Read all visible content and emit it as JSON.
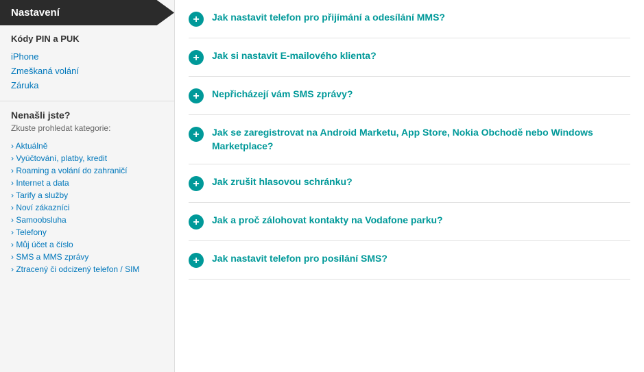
{
  "sidebar": {
    "header": "Nastavení",
    "section1": {
      "title": "Kódy PIN a PUK",
      "links": [
        {
          "label": "iPhone",
          "href": "#"
        },
        {
          "label": "Zmeškaná volání",
          "href": "#"
        },
        {
          "label": "Záruka",
          "href": "#"
        }
      ]
    },
    "nenasli": {
      "title": "Nenašli jste?",
      "subtitle": "Zkuste prohledat kategorie:",
      "categories": [
        {
          "label": "Aktuálně"
        },
        {
          "label": "Vyúčtování, platby, kredit"
        },
        {
          "label": "Roaming a volání do zahraničí"
        },
        {
          "label": "Internet a data"
        },
        {
          "label": "Tarify a služby"
        },
        {
          "label": "Noví zákazníci"
        },
        {
          "label": "Samoobsluha"
        },
        {
          "label": "Telefony"
        },
        {
          "label": "Můj účet a číslo"
        },
        {
          "label": "SMS a MMS zprávy"
        },
        {
          "label": "Ztracený či odcizený telefon / SIM"
        }
      ]
    }
  },
  "faq": {
    "items": [
      {
        "question": "Jak nastavit telefon pro přijímání a odesílání MMS?"
      },
      {
        "question": "Jak si nastavit E-mailového klienta?"
      },
      {
        "question": "Nepřicházejí vám SMS zprávy?"
      },
      {
        "question": "Jak se zaregistrovat na Android Marketu, App Store, Nokia Obchodě nebo Windows Marketplace?"
      },
      {
        "question": "Jak zrušit hlasovou schránku?"
      },
      {
        "question": "Jak a proč zálohovat kontakty na Vodafone parku?"
      },
      {
        "question": "Jak nastavit telefon pro posílání SMS?"
      }
    ]
  }
}
